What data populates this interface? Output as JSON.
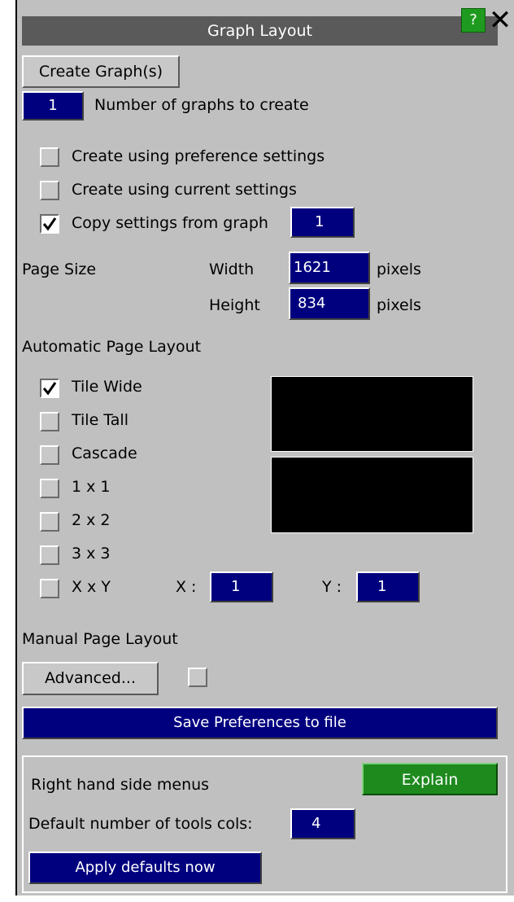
{
  "window": {
    "title": "Graph Layout",
    "help_label": "?",
    "close_label": "✕"
  },
  "create": {
    "button_label": "Create Graph(s)",
    "count_value": "1",
    "count_label": "Number of graphs to create"
  },
  "options": [
    {
      "label": "Create using preference settings",
      "checked": false
    },
    {
      "label": "Create using current settings",
      "checked": false
    },
    {
      "label": "Copy settings from graph",
      "checked": true,
      "value": "1"
    }
  ],
  "page_size": {
    "label": "Page Size",
    "width_label": "Width",
    "width_value": "1621",
    "height_label": "Height",
    "height_value": "834",
    "unit": "pixels"
  },
  "auto_layout": {
    "heading": "Automatic Page Layout",
    "items": [
      {
        "label": "Tile Wide",
        "checked": true
      },
      {
        "label": "Tile Tall",
        "checked": false
      },
      {
        "label": "Cascade",
        "checked": false
      },
      {
        "label": "1 x 1",
        "checked": false
      },
      {
        "label": "2 x 2",
        "checked": false
      },
      {
        "label": "3 x 3",
        "checked": false
      },
      {
        "label": "X x Y",
        "checked": false
      }
    ],
    "x_label": "X :",
    "x_value": "1",
    "y_label": "Y :",
    "y_value": "1"
  },
  "manual_layout": {
    "heading": "Manual Page Layout",
    "advanced_label": "Advanced..."
  },
  "save_prefs_label": "Save Preferences to file",
  "rhs_menus": {
    "label": "Right hand side menus",
    "explain_label": "Explain",
    "cols_label": "Default number of tools cols:",
    "cols_value": "4",
    "apply_label": "Apply defaults now"
  },
  "colors": {
    "panel_bg": "#c0c0c0",
    "field_navy": "#00007f",
    "explain_green": "#1e8a1e",
    "title_gray": "#5a5a5a"
  }
}
